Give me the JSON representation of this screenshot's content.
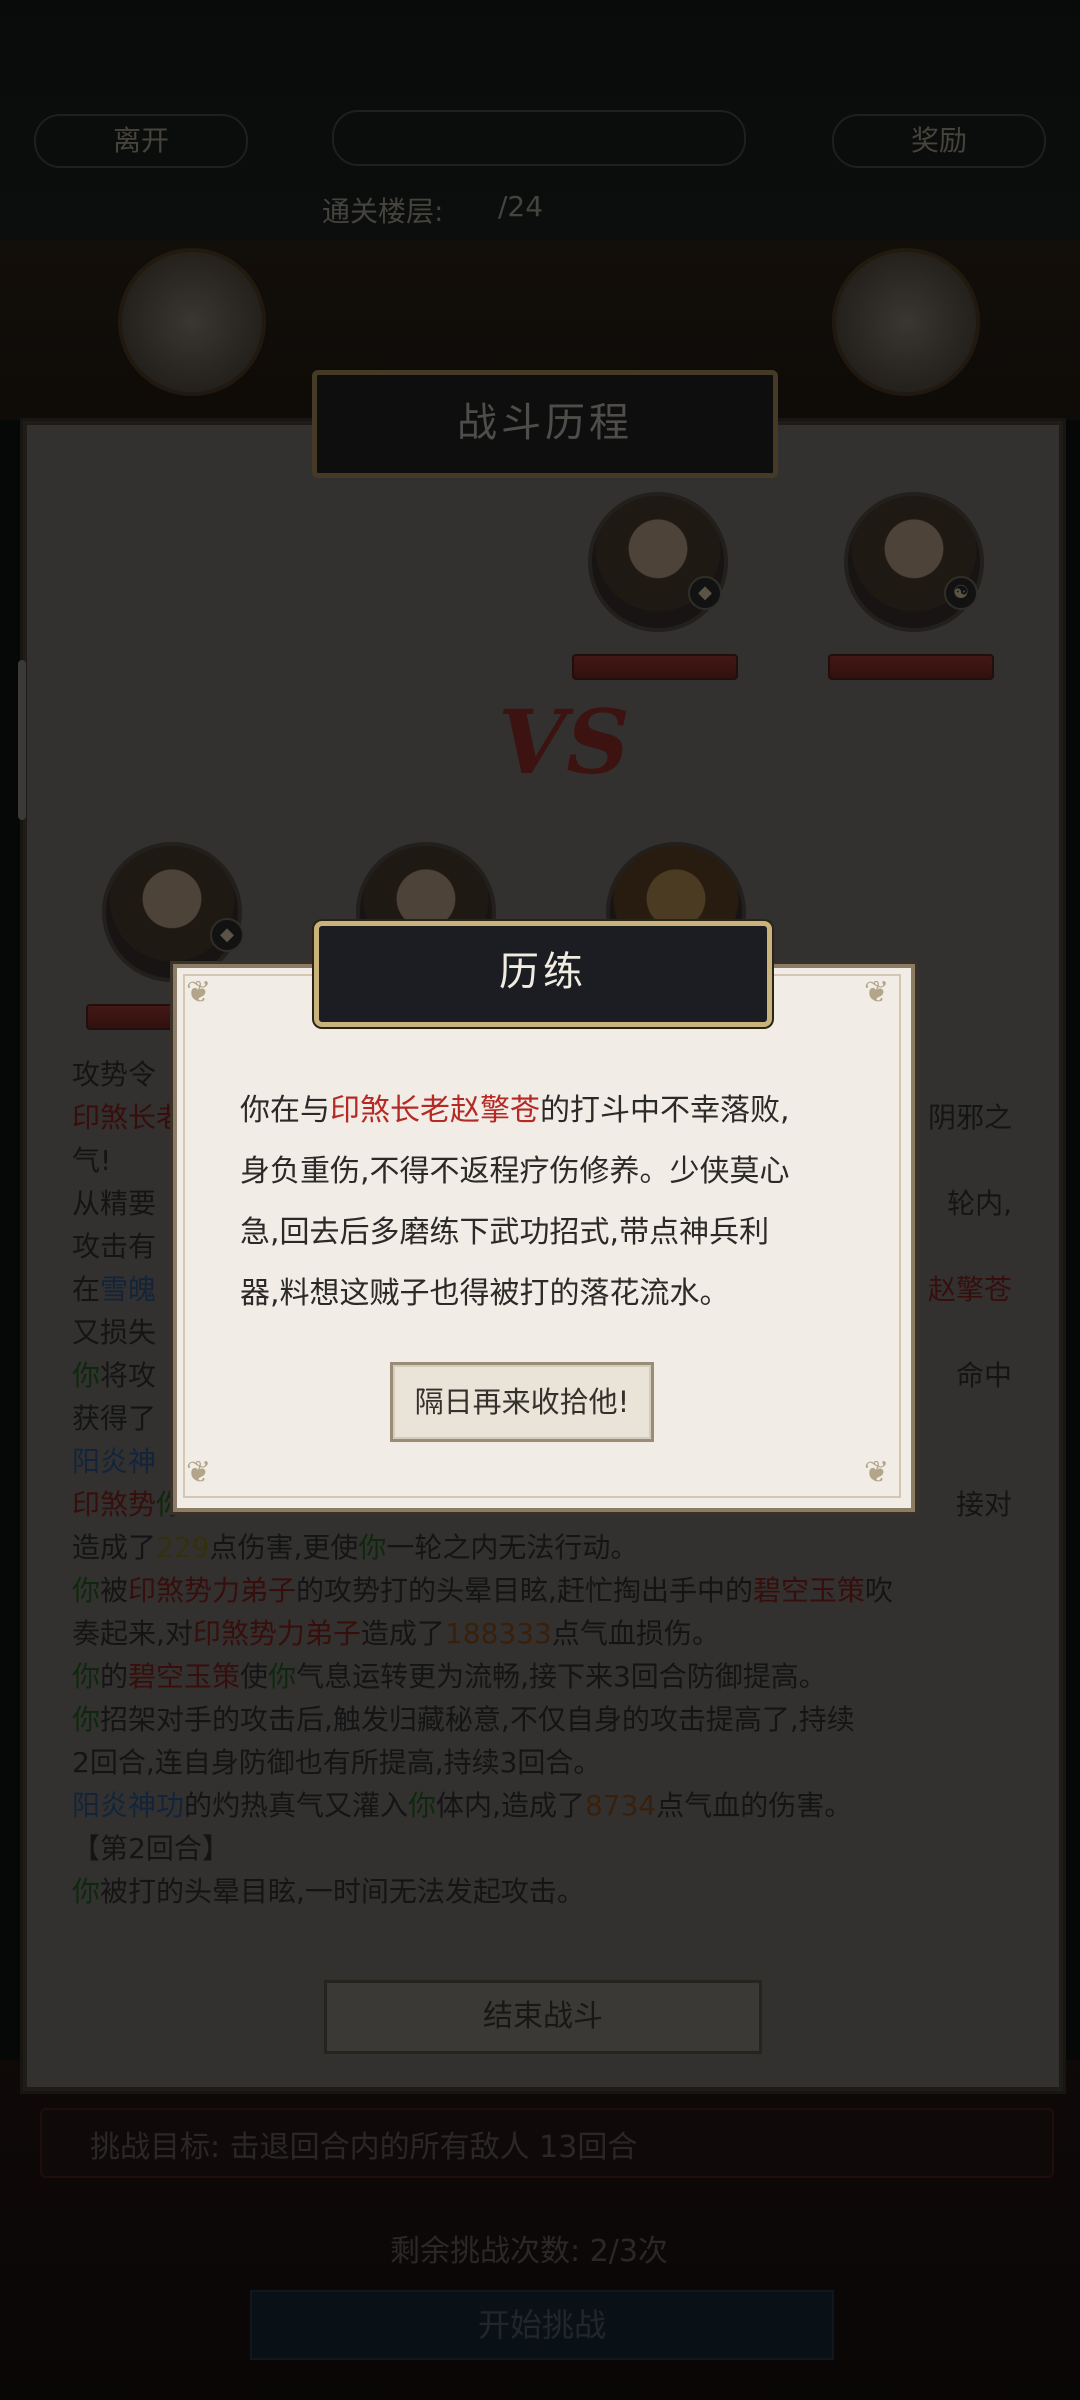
{
  "background": {
    "leave_label": "离开",
    "reward_label": "奖励",
    "floor_label": "通关楼层:",
    "floor_value": "/24",
    "goal_text": "挑战目标: 击退回合内的所有敌人 13回合",
    "remaining_text": "剩余挑战次数: 2/3次",
    "start_label": "开始挑战"
  },
  "battle": {
    "title": "战斗历程",
    "vs": "VS",
    "end_label": "结束战斗",
    "log": [
      [
        {
          "t": "攻势令",
          "c": ""
        }
      ],
      [
        {
          "t": "印煞长老",
          "c": "red"
        },
        {
          "t": "",
          "c": ""
        },
        {
          "t": "阴邪之",
          "c": "far"
        }
      ],
      [
        {
          "t": "气!",
          "c": ""
        }
      ],
      [
        {
          "t": "从精要",
          "c": ""
        },
        {
          "t": "轮内,",
          "c": "far"
        }
      ],
      [
        {
          "t": "攻击有",
          "c": ""
        }
      ],
      [
        {
          "t": "在",
          "c": ""
        },
        {
          "t": "雪魄",
          "c": "blue"
        },
        {
          "t": "赵擎苍",
          "c": "far-red"
        }
      ],
      [
        {
          "t": "又损失",
          "c": ""
        }
      ],
      [
        {
          "t": "你",
          "c": "green"
        },
        {
          "t": "将攻",
          "c": ""
        },
        {
          "t": "命中",
          "c": "far"
        }
      ],
      [
        {
          "t": "获得了",
          "c": ""
        }
      ],
      [
        {
          "t": "阳炎神",
          "c": "blue"
        }
      ],
      [
        {
          "t": "印煞势",
          "c": "red"
        },
        {
          "t": "接对",
          "c": "far"
        },
        {
          "t": "你",
          "c": "green"
        }
      ],
      [
        {
          "t": "造成了",
          "c": ""
        },
        {
          "t": "229",
          "c": "yellow"
        },
        {
          "t": "点伤害,更使",
          "c": ""
        },
        {
          "t": "你",
          "c": "green"
        },
        {
          "t": "一轮之内无法行动。",
          "c": ""
        }
      ],
      [
        {
          "t": "你",
          "c": "green"
        },
        {
          "t": "被",
          "c": ""
        },
        {
          "t": "印煞势力弟子",
          "c": "red"
        },
        {
          "t": "的攻势打的头晕目眩,赶忙掏出手中的",
          "c": ""
        },
        {
          "t": "碧空玉策",
          "c": "red"
        },
        {
          "t": "吹",
          "c": ""
        }
      ],
      [
        {
          "t": "奏起来,对",
          "c": ""
        },
        {
          "t": "印煞势力弟子",
          "c": "red"
        },
        {
          "t": "造成了",
          "c": ""
        },
        {
          "t": "188333",
          "c": "orange"
        },
        {
          "t": "点气血损伤。",
          "c": ""
        }
      ],
      [
        {
          "t": "你",
          "c": "green"
        },
        {
          "t": "的",
          "c": ""
        },
        {
          "t": "碧空玉策",
          "c": "red"
        },
        {
          "t": "使",
          "c": ""
        },
        {
          "t": "你",
          "c": "green"
        },
        {
          "t": "气息运转更为流畅,接下来3回合防御提高。",
          "c": ""
        }
      ],
      [
        {
          "t": "你",
          "c": "green"
        },
        {
          "t": "招架对手的攻击后,触发归藏秘意,不仅自身的攻击提高了,持续",
          "c": ""
        }
      ],
      [
        {
          "t": "2回合,连自身防御也有所提高,持续3回合。",
          "c": ""
        }
      ],
      [
        {
          "t": "阳炎神功",
          "c": "blue"
        },
        {
          "t": "的灼热真气又灌入",
          "c": ""
        },
        {
          "t": "你",
          "c": "green"
        },
        {
          "t": "体内,造成了",
          "c": ""
        },
        {
          "t": "8734",
          "c": "orange"
        },
        {
          "t": "点气血的伤害。",
          "c": ""
        }
      ],
      [
        {
          "t": "【第2回合】",
          "c": ""
        }
      ],
      [
        {
          "t": "你",
          "c": "green"
        },
        {
          "t": "被打的头晕目眩,一时间无法发起攻击。",
          "c": ""
        }
      ]
    ]
  },
  "modal": {
    "title": "历练",
    "line1_prefix": "你在与",
    "line1_name": "印煞长老赵擎苍",
    "line1_suffix": "的打斗中不幸落败,",
    "line2": "身负重伤,不得不返程疗伤修养。少侠莫心",
    "line3": "急,回去后多磨练下武功招式,带点神兵利",
    "line4": "器,料想这贼子也得被打的落花流水。",
    "confirm_label": "隔日再来收拾他!"
  },
  "colors": {
    "highlight_red": "#b52a24",
    "title_plate_border": "#c9b27c",
    "dialog_bg": "#f1ece6"
  }
}
